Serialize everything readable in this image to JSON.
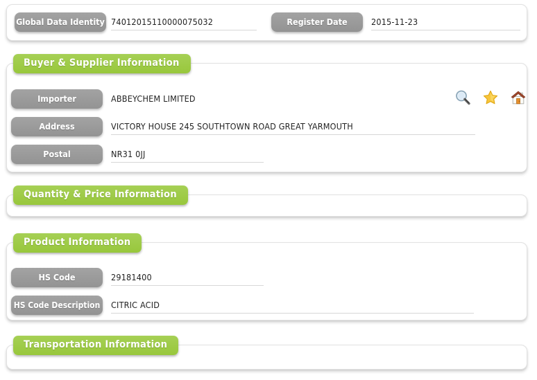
{
  "identity": {
    "global_data_identity_label": "Global Data Identity",
    "global_data_identity_value": "74012015110000075032",
    "register_date_label": "Register Date",
    "register_date_value": "2015-11-23"
  },
  "buyer_supplier": {
    "section_title": "Buyer & Supplier Information",
    "importer_label": "Importer",
    "importer_value": "ABBEYCHEM LIMITED",
    "address_label": "Address",
    "address_value": "VICTORY HOUSE 245 SOUTHTOWN ROAD GREAT YARMOUTH",
    "postal_label": "Postal",
    "postal_value": "NR31 0JJ",
    "actions": [
      {
        "name": "search-icon",
        "title": "Search"
      },
      {
        "name": "star-icon",
        "title": "Favorite"
      },
      {
        "name": "home-icon",
        "title": "Home"
      }
    ]
  },
  "quantity_price": {
    "section_title": "Quantity & Price Information"
  },
  "product": {
    "section_title": "Product Information",
    "hs_code_label": "HS Code",
    "hs_code_value": "29181400",
    "hs_code_description_label": "HS Code Description",
    "hs_code_description_value": "CITRIC ACID"
  },
  "transportation": {
    "section_title": "Transportation Information"
  },
  "colors": {
    "accent_green": "#9ecb47",
    "label_gray": "#9b9b9b",
    "card_border": "#e2e2e2",
    "underline": "#d7d7d7",
    "value_text": "#222222"
  }
}
